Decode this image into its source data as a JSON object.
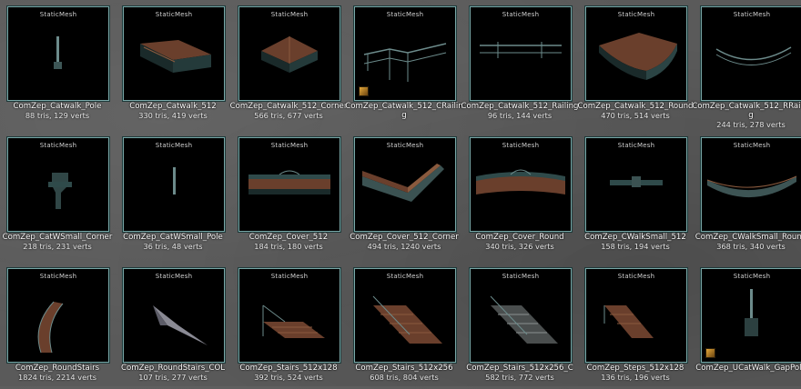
{
  "type_label": "StaticMesh",
  "assets": [
    {
      "name": "ComZep_Catwalk_Pole",
      "stats": "88 tris, 129 verts",
      "badge": false,
      "icon": "pole-mesh-icon"
    },
    {
      "name": "ComZep_Catwalk_512",
      "stats": "330 tris, 419 verts",
      "badge": false,
      "icon": "catwalk-platform-icon"
    },
    {
      "name": "ComZep_Catwalk_512_Corner",
      "stats": "566 tris, 677 verts",
      "badge": false,
      "icon": "catwalk-corner-icon"
    },
    {
      "name": "ComZep_Catwalk_512_CRailing",
      "stats": "",
      "badge": true,
      "icon": "corner-railing-icon"
    },
    {
      "name": "ComZep_Catwalk_512_Railing",
      "stats": "96 tris, 144 verts",
      "badge": false,
      "icon": "railing-icon"
    },
    {
      "name": "ComZep_Catwalk_512_Round",
      "stats": "470 tris, 514 verts",
      "badge": false,
      "icon": "catwalk-round-icon"
    },
    {
      "name": "ComZep_Catwalk_512_RRailing",
      "stats": "244 tris, 278 verts",
      "badge": false,
      "icon": "round-railing-icon"
    },
    {
      "name": "ComZep_CatWSmall_Corner",
      "stats": "218 tris, 231 verts",
      "badge": false,
      "icon": "small-corner-icon"
    },
    {
      "name": "ComZep_CatWSmall_Pole",
      "stats": "36 tris, 48 verts",
      "badge": false,
      "icon": "small-pole-icon"
    },
    {
      "name": "ComZep_Cover_512",
      "stats": "184 tris, 180 verts",
      "badge": false,
      "icon": "cover-icon"
    },
    {
      "name": "ComZep_Cover_512_Corner",
      "stats": "494 tris, 1240 verts",
      "badge": false,
      "icon": "cover-corner-icon"
    },
    {
      "name": "ComZep_Cover_Round",
      "stats": "340 tris, 326 verts",
      "badge": false,
      "icon": "cover-round-icon"
    },
    {
      "name": "ComZep_CWalkSmall_512",
      "stats": "158 tris, 194 verts",
      "badge": false,
      "icon": "walk-small-icon"
    },
    {
      "name": "ComZep_CWalkSmall_Round",
      "stats": "368 tris, 340 verts",
      "badge": false,
      "icon": "walk-small-round-icon"
    },
    {
      "name": "ComZep_RoundStairs",
      "stats": "1824 tris, 2214 verts",
      "badge": false,
      "icon": "round-stairs-icon"
    },
    {
      "name": "ComZep_RoundStairs_COL",
      "stats": "107 tris, 277 verts",
      "badge": false,
      "icon": "stairs-collision-icon"
    },
    {
      "name": "ComZep_Stairs_512x128",
      "stats": "392 tris, 524 verts",
      "badge": false,
      "icon": "stairs-128-icon"
    },
    {
      "name": "ComZep_Stairs_512x256",
      "stats": "608 tris, 804 verts",
      "badge": false,
      "icon": "stairs-256-icon"
    },
    {
      "name": "ComZep_Stairs_512x256_C",
      "stats": "582 tris, 772 verts",
      "badge": false,
      "icon": "stairs-256c-icon"
    },
    {
      "name": "ComZep_Steps_512x128",
      "stats": "136 tris, 196 verts",
      "badge": false,
      "icon": "steps-icon"
    },
    {
      "name": "ComZep_UCatWalk_GapPole",
      "stats": "",
      "badge": true,
      "icon": "gap-pole-icon"
    }
  ]
}
